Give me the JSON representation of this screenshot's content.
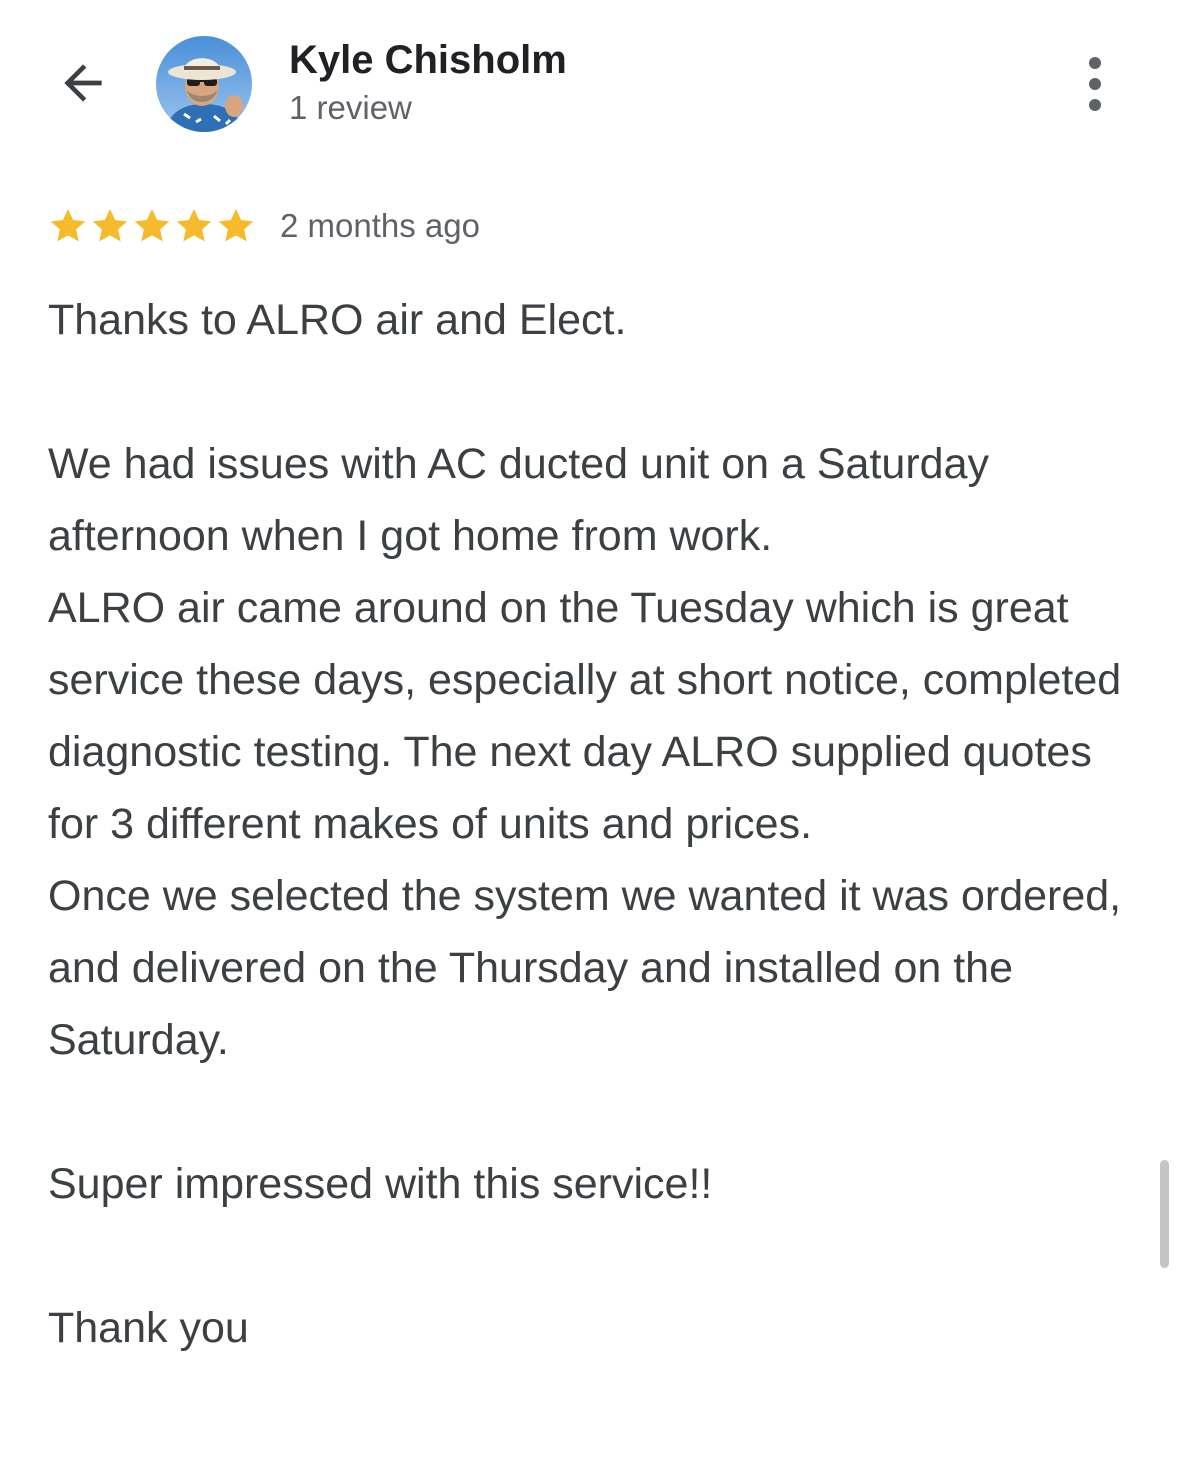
{
  "header": {
    "back_icon": "arrow-back-icon",
    "reviewer_name": "Kyle Chisholm",
    "review_count": "1 review",
    "more_icon": "more-vert-icon"
  },
  "review": {
    "rating": 5,
    "rating_max": 5,
    "star_color": "#f6bb2d",
    "date": "2 months ago",
    "text": "Thanks to ALRO air and Elect.\n\nWe had issues with AC ducted unit on a Saturday afternoon when I got home from work.\nALRO air came around on the Tuesday which is great service these days, especially at short notice, completed diagnostic testing. The next day ALRO supplied quotes for 3 different makes of units and prices.\nOnce we selected the system we wanted it was ordered, and delivered on the Thursday and installed on the Saturday.\n\nSuper impressed with this service!!\n\nThank you"
  }
}
